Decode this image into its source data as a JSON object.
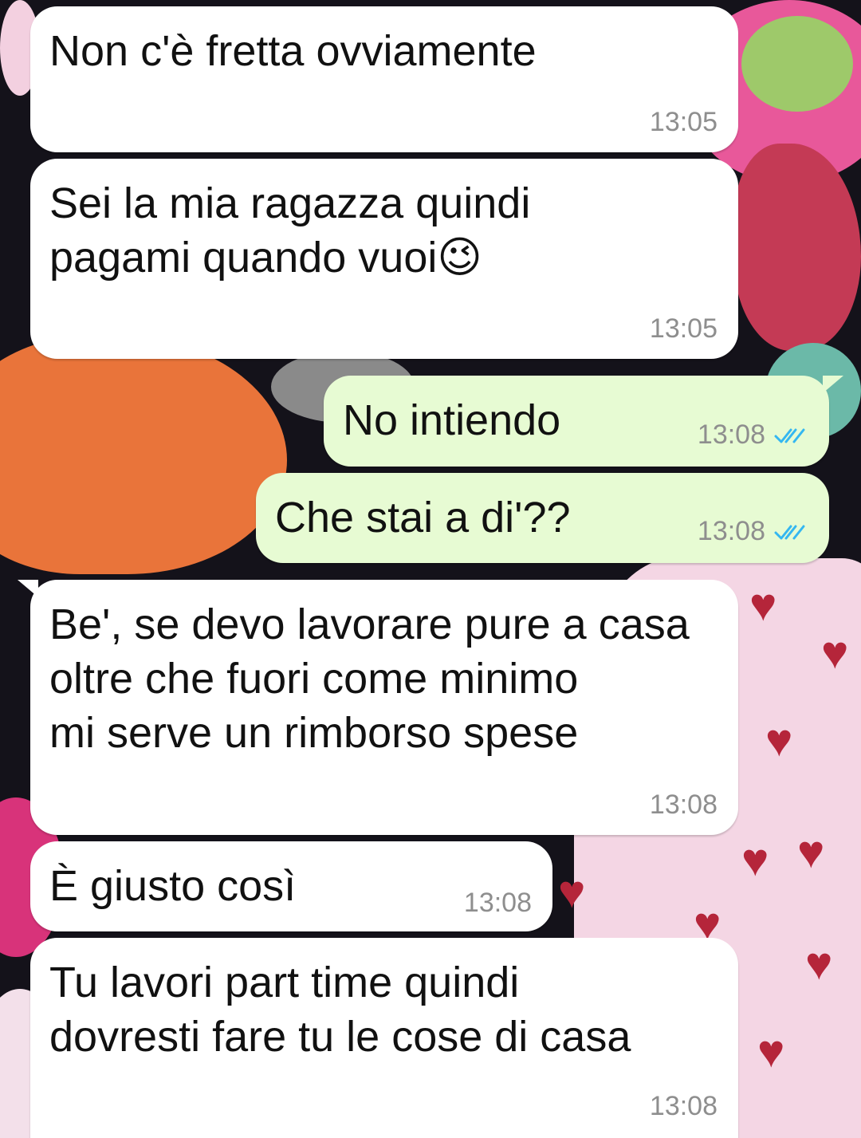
{
  "chat": {
    "messages": [
      {
        "id": "m1",
        "direction": "incoming",
        "text": "Non c'è fretta ovviamente",
        "time": "13:05"
      },
      {
        "id": "m2",
        "direction": "incoming",
        "text": "Sei la mia ragazza quindi\npagami quando vuoi😉",
        "time": "13:05"
      },
      {
        "id": "m3",
        "direction": "outgoing",
        "text": "No intiendo",
        "time": "13:08",
        "status": "read"
      },
      {
        "id": "m4",
        "direction": "outgoing",
        "text": "Che stai a di'??",
        "time": "13:08",
        "status": "read"
      },
      {
        "id": "m5",
        "direction": "incoming",
        "text": "Be', se devo lavorare pure a casa\noltre che fuori come minimo\nmi serve un rimborso spese",
        "time": "13:08"
      },
      {
        "id": "m6",
        "direction": "incoming",
        "text": "È giusto così",
        "time": "13:08"
      },
      {
        "id": "m7",
        "direction": "incoming",
        "text": "Tu lavori part time quindi\ndovresti fare tu le cose di casa",
        "time": "13:08"
      }
    ]
  },
  "colors": {
    "incoming_bubble": "#ffffff",
    "outgoing_bubble": "#e7fbd3",
    "read_ticks": "#34b7f1",
    "timestamp": "#8e8e8e"
  },
  "icons": {
    "read_status": "double-check-icon"
  }
}
